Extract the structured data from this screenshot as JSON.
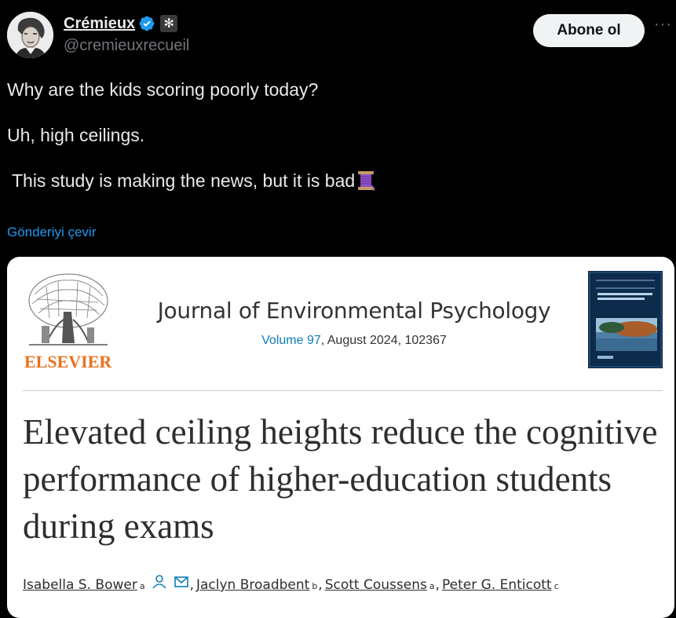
{
  "author": {
    "display_name": "Crémieux",
    "handle": "@cremieuxrecueil",
    "avatar_icon": "avatar-portrait-icon",
    "verified_icon": "verified-badge-icon",
    "affiliate_icon": "affiliate-badge-icon"
  },
  "actions": {
    "follow_label": "Abone ol",
    "more_label": "···",
    "translate_label": "Gönderiyi çevir"
  },
  "tweet": {
    "lines": [
      "Why are the kids scoring poorly today?",
      "",
      "Uh, high ceilings.",
      "",
      " This study is making the news, but it is bad"
    ],
    "emoji_icon": "thread-spool-icon"
  },
  "paper": {
    "publisher": "ELSEVIER",
    "journal": "Journal of Environmental Psychology",
    "volume": "Volume 97",
    "issue_info": ", August 2024, 102367",
    "title": "Elevated ceiling heights reduce the cognitive performance of higher-education students during exams",
    "authors": [
      {
        "name": "Isabella S. Bower",
        "sup": "a"
      },
      {
        "name": "Jaclyn Broadbent",
        "sup": "b"
      },
      {
        "name": "Scott Coussens",
        "sup": "a"
      },
      {
        "name": "Peter G. Enticott",
        "sup": "c"
      }
    ]
  },
  "colors": {
    "accent_link": "#1d9bf0",
    "verified": "#1d9bf0",
    "elsevier_orange": "#e9711c",
    "volume_link": "#0c7dbb"
  }
}
